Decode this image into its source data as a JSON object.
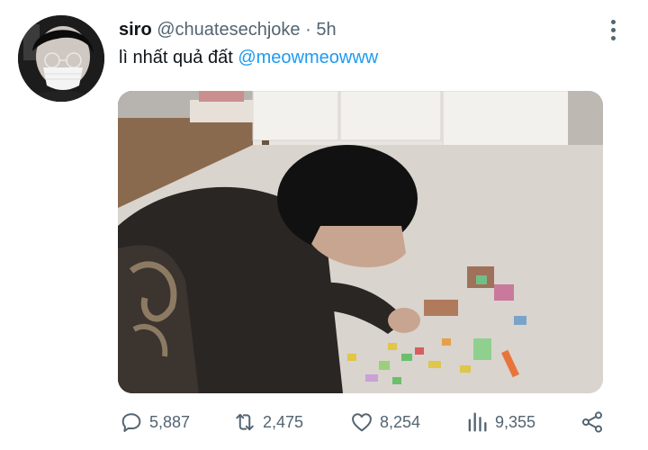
{
  "tweet": {
    "author_name": "siro",
    "author_handle": "@chuatesechjoke",
    "separator": "·",
    "time": "5h",
    "text": "lì nhất quả đất",
    "mention": "@meowmeowww"
  },
  "actions": {
    "reply_count": "5,887",
    "retweet_count": "2,475",
    "like_count": "8,254",
    "views_count": "9,355"
  },
  "icons": {
    "more": "more-vertical-icon",
    "reply": "reply-icon",
    "retweet": "retweet-icon",
    "like": "heart-icon",
    "views": "views-icon",
    "share": "share-icon"
  },
  "colors": {
    "link": "#1d9bf0",
    "secondary_text": "#536471",
    "primary_text": "#0f1419"
  }
}
